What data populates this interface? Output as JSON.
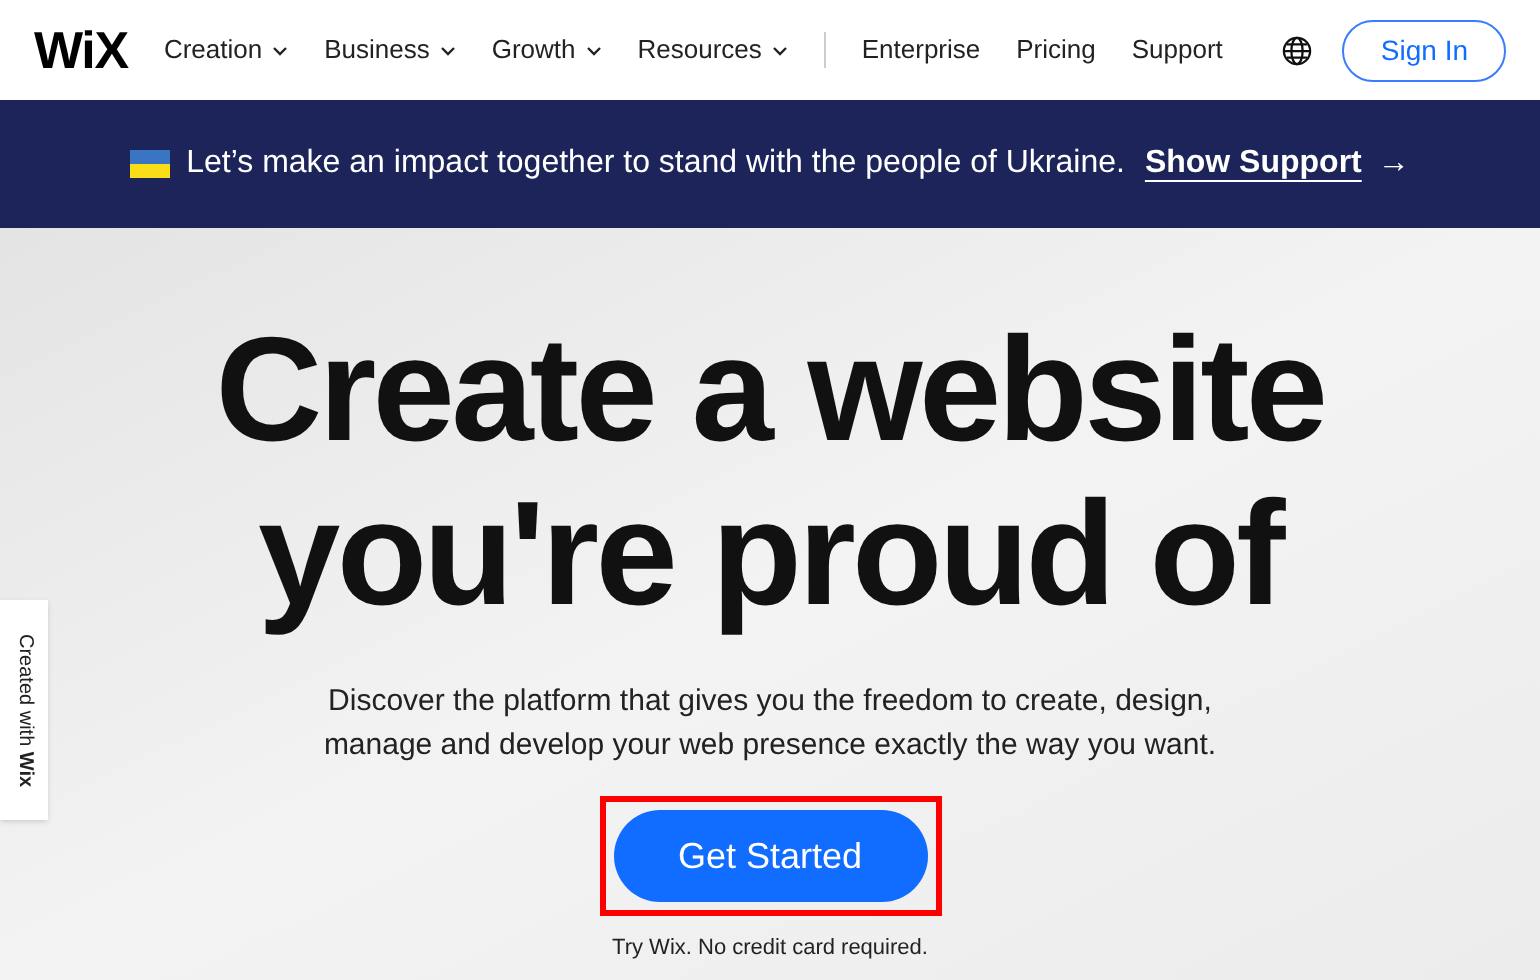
{
  "header": {
    "logo": "WiX",
    "nav": [
      {
        "label": "Creation",
        "kind": "dropdown"
      },
      {
        "label": "Business",
        "kind": "dropdown"
      },
      {
        "label": "Growth",
        "kind": "dropdown"
      },
      {
        "label": "Resources",
        "kind": "dropdown"
      },
      {
        "label": "Enterprise",
        "kind": "link"
      },
      {
        "label": "Pricing",
        "kind": "link"
      },
      {
        "label": "Support",
        "kind": "link"
      }
    ],
    "sign_in": "Sign In"
  },
  "banner": {
    "message": "Let’s make an impact together to stand with the people of Ukraine.",
    "link": "Show Support",
    "arrow": "→"
  },
  "hero": {
    "title_lines": [
      "Create a website",
      "you're proud of"
    ],
    "subtitle": "Discover the platform that gives you the freedom to create, design, manage and develop your web presence exactly the way you want.",
    "cta": "Get Started",
    "cta_highlighted": true,
    "note": "Try Wix. No credit card required."
  },
  "side_tab": "Created with **Wix**"
}
